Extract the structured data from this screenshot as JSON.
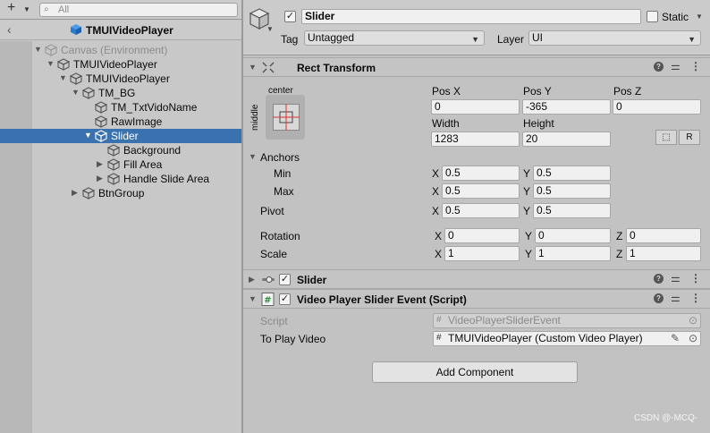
{
  "hierarchy": {
    "search_placeholder": "All",
    "add_label": "+",
    "title": "TMUIVideoPlayer",
    "items": [
      {
        "label": "Canvas (Environment)",
        "depth": 0,
        "arrow": "open",
        "dim": true,
        "selected": false
      },
      {
        "label": "TMUIVideoPlayer",
        "depth": 1,
        "arrow": "open",
        "dim": false,
        "selected": false
      },
      {
        "label": "TMUIVideoPlayer",
        "depth": 2,
        "arrow": "open",
        "dim": false,
        "selected": false
      },
      {
        "label": "TM_BG",
        "depth": 3,
        "arrow": "open",
        "dim": false,
        "selected": false
      },
      {
        "label": "TM_TxtVidoName",
        "depth": 4,
        "arrow": "none",
        "dim": false,
        "selected": false
      },
      {
        "label": "RawImage",
        "depth": 4,
        "arrow": "none",
        "dim": false,
        "selected": false
      },
      {
        "label": "Slider",
        "depth": 4,
        "arrow": "open",
        "dim": false,
        "selected": true
      },
      {
        "label": "Background",
        "depth": 5,
        "arrow": "none",
        "dim": false,
        "selected": false
      },
      {
        "label": "Fill Area",
        "depth": 5,
        "arrow": "closed",
        "dim": false,
        "selected": false
      },
      {
        "label": "Handle Slide Area",
        "depth": 5,
        "arrow": "closed",
        "dim": false,
        "selected": false
      },
      {
        "label": "BtnGroup",
        "depth": 3,
        "arrow": "closed",
        "dim": false,
        "selected": false
      }
    ]
  },
  "inspector": {
    "object_name": "Slider",
    "active_checked": "✓",
    "static_label": "Static",
    "tag_label": "Tag",
    "tag_value": "Untagged",
    "layer_label": "Layer",
    "layer_value": "UI",
    "rect_transform": {
      "title": "Rect Transform",
      "anchor_preset_h": "center",
      "anchor_preset_v": "middle",
      "pos_x_label": "Pos X",
      "pos_x": "0",
      "pos_y_label": "Pos Y",
      "pos_y": "-365",
      "pos_z_label": "Pos Z",
      "pos_z": "0",
      "width_label": "Width",
      "width": "1283",
      "height_label": "Height",
      "height": "20",
      "raw_btn": "R",
      "anchors_label": "Anchors",
      "min_label": "Min",
      "min_x": "0.5",
      "min_y": "0.5",
      "max_label": "Max",
      "max_x": "0.5",
      "max_y": "0.5",
      "pivot_label": "Pivot",
      "pivot_x": "0.5",
      "pivot_y": "0.5",
      "rotation_label": "Rotation",
      "rot_x": "0",
      "rot_y": "0",
      "rot_z": "0",
      "scale_label": "Scale",
      "scale_x": "1",
      "scale_y": "1",
      "scale_z": "1",
      "x": "X",
      "y": "Y",
      "z": "Z"
    },
    "slider_comp": {
      "title": "Slider",
      "checked": "✓"
    },
    "script_comp": {
      "title": "Video Player Slider Event (Script)",
      "checked": "✓",
      "script_label": "Script",
      "script_value": "VideoPlayerSliderEvent",
      "to_play_label": "To Play Video",
      "to_play_value": "TMUIVideoPlayer (Custom Video Player)"
    },
    "add_component": "Add Component"
  },
  "watermark": "CSDN @-MCQ-",
  "colors": {
    "selection": "#3a72b0",
    "accent_blue": "#2a7bd3"
  }
}
